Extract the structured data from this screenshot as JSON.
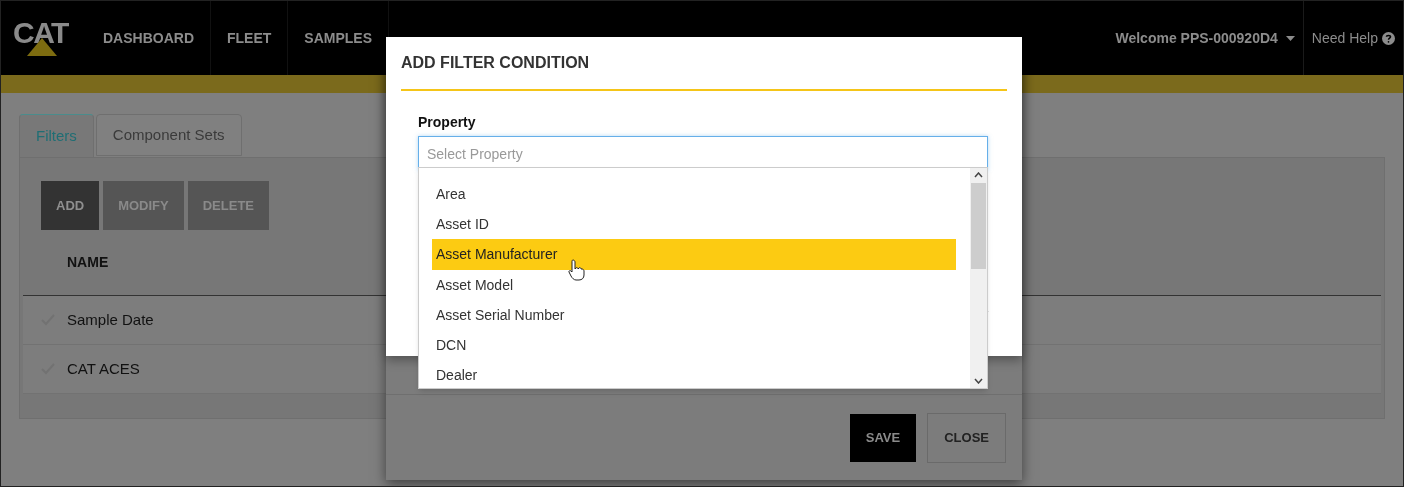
{
  "header": {
    "logo": "CAT",
    "nav": [
      {
        "label": "DASHBOARD"
      },
      {
        "label": "FLEET"
      },
      {
        "label": "SAMPLES"
      }
    ],
    "welcome": "Welcome PPS-000920D4",
    "help": "Need Help"
  },
  "tabs": [
    {
      "label": "Filters",
      "selected": true
    },
    {
      "label": "Component Sets",
      "selected": false
    }
  ],
  "toolbar": [
    {
      "label": "ADD",
      "disabled": false
    },
    {
      "label": "MODIFY",
      "disabled": true
    },
    {
      "label": "DELETE",
      "disabled": true
    }
  ],
  "table": {
    "columns": [
      "NAME"
    ],
    "rows": [
      {
        "name": "Sample Date"
      },
      {
        "name": "CAT ACES"
      }
    ]
  },
  "back_dialog": {
    "buttons": [
      {
        "label": "SAVE",
        "kind": "primary"
      },
      {
        "label": "CLOSE",
        "kind": "secondary"
      }
    ]
  },
  "dialog": {
    "title": "ADD FILTER CONDITION",
    "field_label": "Property",
    "placeholder": "Select Property",
    "options": [
      {
        "label": "Area",
        "selected": false
      },
      {
        "label": "Asset ID",
        "selected": false
      },
      {
        "label": "Asset Manufacturer",
        "selected": true
      },
      {
        "label": "Asset Model",
        "selected": false
      },
      {
        "label": "Asset Serial Number",
        "selected": false
      },
      {
        "label": "DCN",
        "selected": false
      },
      {
        "label": "Dealer",
        "selected": false
      }
    ]
  }
}
